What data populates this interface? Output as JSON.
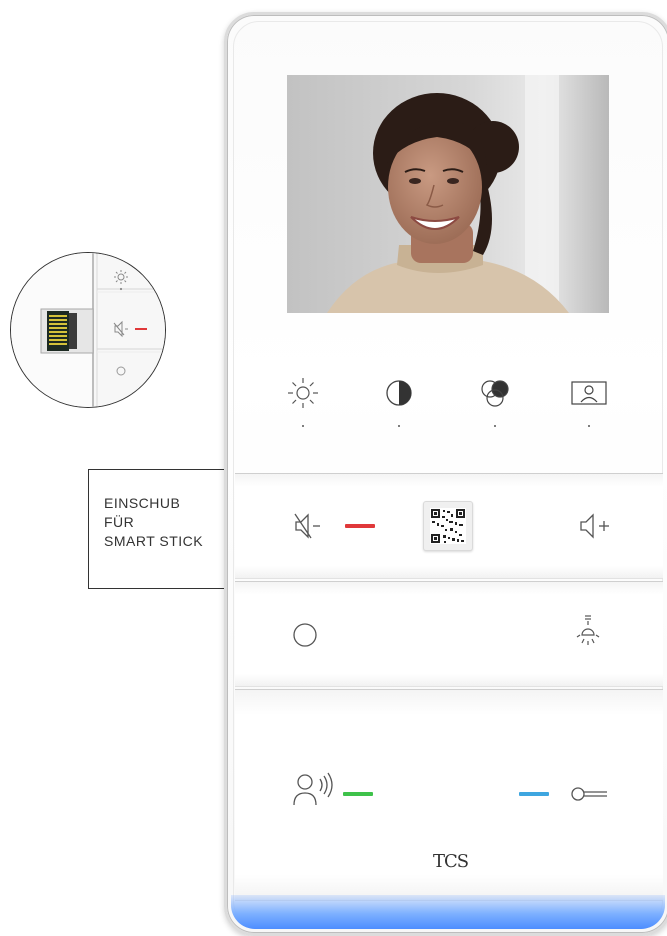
{
  "callout": {
    "line1": "EINSCHUB",
    "line2": "FÜR",
    "line3": "SMART STICK"
  },
  "device": {
    "logo": "TCS",
    "display_icons": [
      "brightness-icon",
      "contrast-icon",
      "color-saturation-icon",
      "camera-image-icon"
    ],
    "row1_icons": [
      "mute-icon",
      "qr-code",
      "volume-up-icon"
    ],
    "row2_icons": [
      "circle-function-icon",
      "light-icon"
    ],
    "row3_icons": [
      "talk-icon",
      "door-key-icon"
    ],
    "colors": {
      "mute_led": "#e0383a",
      "talk_led": "#3ec24a",
      "door_led": "#3ea6e0",
      "glow": "#5b97ff"
    }
  },
  "zoom": {
    "icons": [
      "brightness-icon",
      "mute-icon",
      "circle-function-icon"
    ],
    "mute_led": "#e0383a"
  }
}
